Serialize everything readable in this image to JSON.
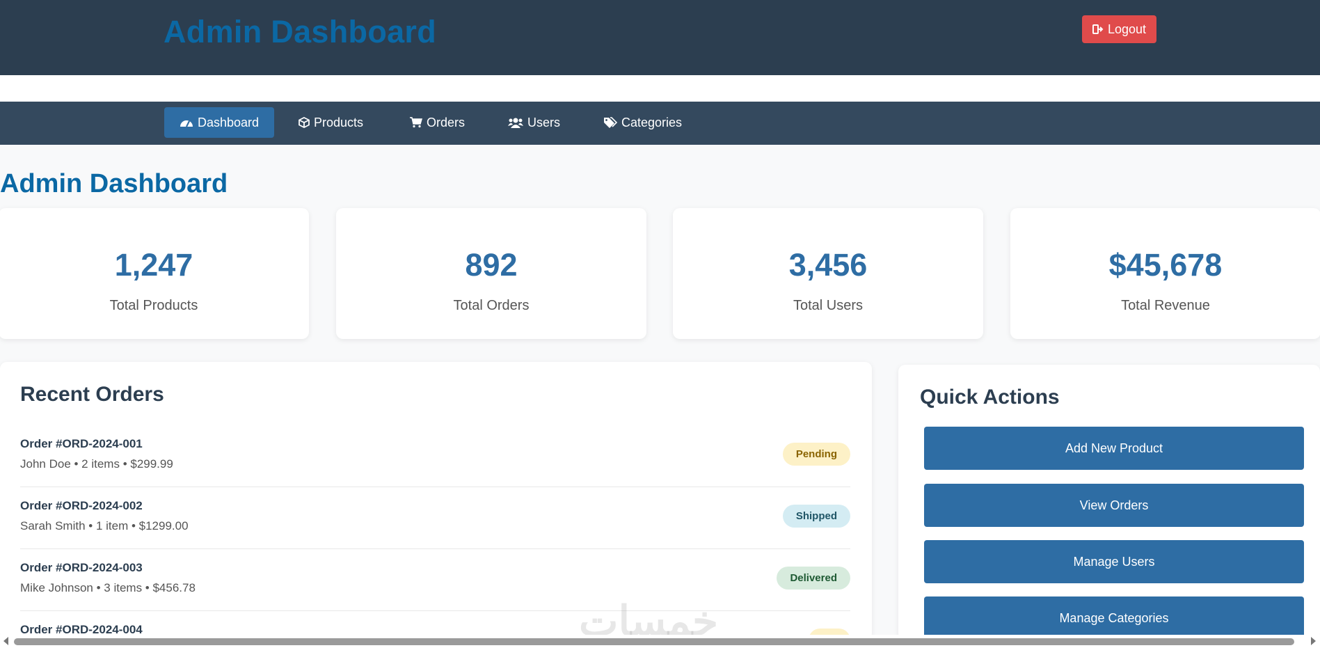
{
  "header": {
    "title": "Admin Dashboard",
    "logout_label": "Logout"
  },
  "nav": [
    {
      "label": "Dashboard",
      "icon": "dashboard-gauge-icon"
    },
    {
      "label": "Products",
      "icon": "cube-icon"
    },
    {
      "label": "Orders",
      "icon": "cart-icon"
    },
    {
      "label": "Users",
      "icon": "users-icon"
    },
    {
      "label": "Categories",
      "icon": "tags-icon"
    }
  ],
  "page": {
    "heading": "Admin Dashboard"
  },
  "stats": [
    {
      "value": "1,247",
      "label": "Total Products"
    },
    {
      "value": "892",
      "label": "Total Orders"
    },
    {
      "value": "3,456",
      "label": "Total Users"
    },
    {
      "value": "$45,678",
      "label": "Total Revenue"
    }
  ],
  "recent_orders": {
    "title": "Recent Orders",
    "orders": [
      {
        "id": "Order #ORD-2024-001",
        "meta": "John Doe • 2 items • $299.99",
        "status": "Pending"
      },
      {
        "id": "Order #ORD-2024-002",
        "meta": "Sarah Smith • 1 item • $1299.00",
        "status": "Shipped"
      },
      {
        "id": "Order #ORD-2024-003",
        "meta": "Mike Johnson • 3 items • $456.78",
        "status": "Delivered"
      },
      {
        "id": "Order #ORD-2024-004",
        "meta": "",
        "status": ""
      }
    ]
  },
  "quick_actions": {
    "title": "Quick Actions",
    "buttons": [
      "Add New Product",
      "View Orders",
      "Manage Users",
      "Manage Categories"
    ]
  },
  "colors": {
    "header_bg": "#2c3e50",
    "nav_bg": "#34495e",
    "accent": "#2e6da4",
    "title_blue": "#0b68a4",
    "logout": "#e04b4b",
    "pending_bg": "#fdf1c7",
    "shipped_bg": "#d4ecf3",
    "delivered_bg": "#d7ebdd"
  },
  "watermark": "خمسات"
}
